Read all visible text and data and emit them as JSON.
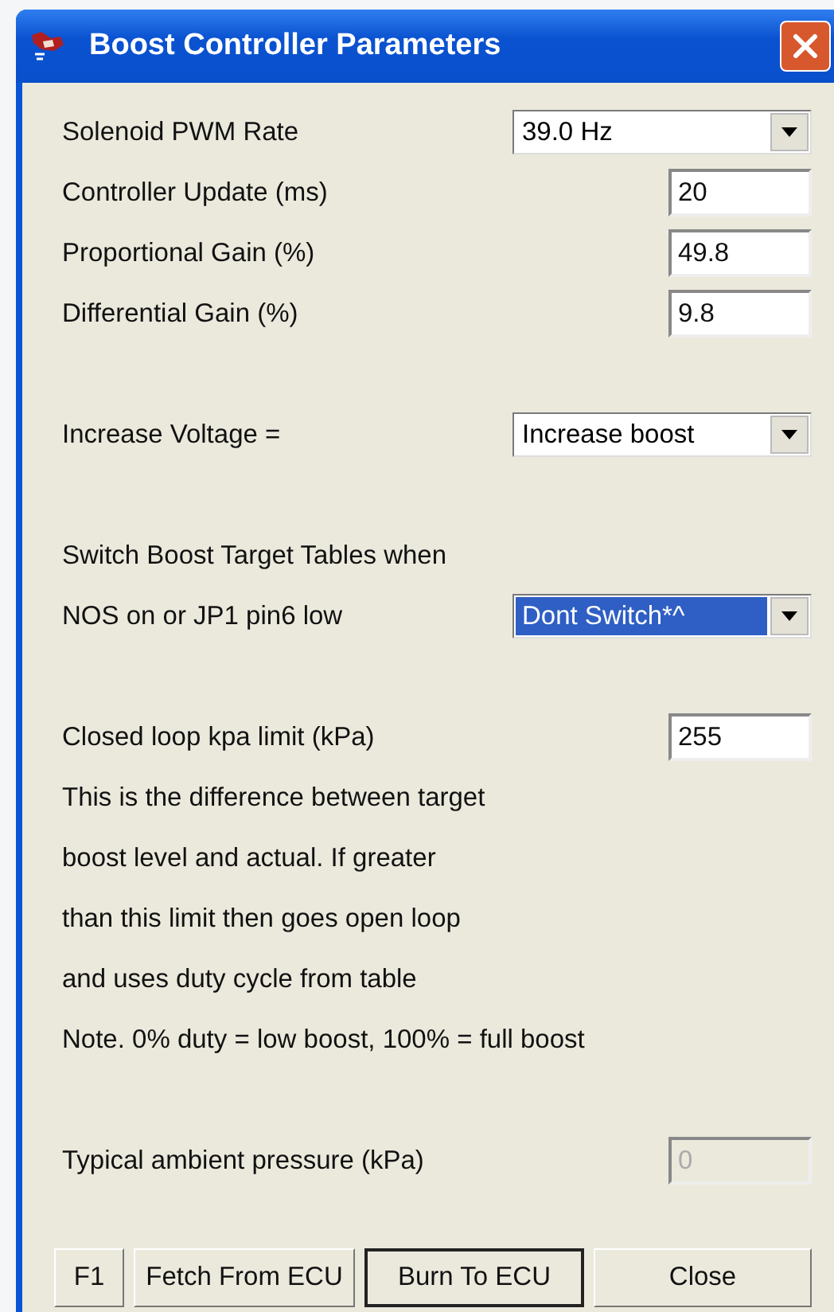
{
  "window": {
    "title": "Boost Controller Parameters"
  },
  "groups": [
    {
      "rows": [
        {
          "kind": "select",
          "label": "Solenoid PWM Rate",
          "value": "39.0 Hz",
          "highlighted": false
        },
        {
          "kind": "input",
          "label": "Controller Update (ms)",
          "value": "20",
          "disabled": false
        },
        {
          "kind": "input",
          "label": "Proportional Gain (%)",
          "value": "49.8",
          "disabled": false
        },
        {
          "kind": "input",
          "label": "Differential Gain (%)",
          "value": "9.8",
          "disabled": false
        }
      ]
    },
    {
      "rows": [
        {
          "kind": "select",
          "label": "Increase Voltage =",
          "value": "Increase boost",
          "highlighted": false
        }
      ]
    },
    {
      "rows": [
        {
          "kind": "text",
          "text": "Switch Boost Target Tables when"
        },
        {
          "kind": "select",
          "label": "NOS on or JP1 pin6 low",
          "value": "Dont Switch*^",
          "highlighted": true
        }
      ]
    },
    {
      "rows": [
        {
          "kind": "input",
          "label": "Closed loop kpa limit (kPa)",
          "value": "255",
          "disabled": false
        },
        {
          "kind": "text",
          "text": "This is the difference between target"
        },
        {
          "kind": "text",
          "text": "boost level and actual. If greater"
        },
        {
          "kind": "text",
          "text": "than this limit then goes open loop"
        },
        {
          "kind": "text",
          "text": "and uses duty cycle from table"
        },
        {
          "kind": "text",
          "text": "Note. 0% duty = low boost, 100% = full boost"
        }
      ]
    },
    {
      "rows": [
        {
          "kind": "input",
          "label": "Typical ambient pressure (kPa)",
          "value": "0",
          "disabled": true
        }
      ]
    }
  ],
  "buttons": [
    {
      "label": "F1",
      "default": false
    },
    {
      "label": "Fetch From ECU",
      "default": false
    },
    {
      "label": "Burn To ECU",
      "default": true
    },
    {
      "label": "Close",
      "default": false
    }
  ]
}
